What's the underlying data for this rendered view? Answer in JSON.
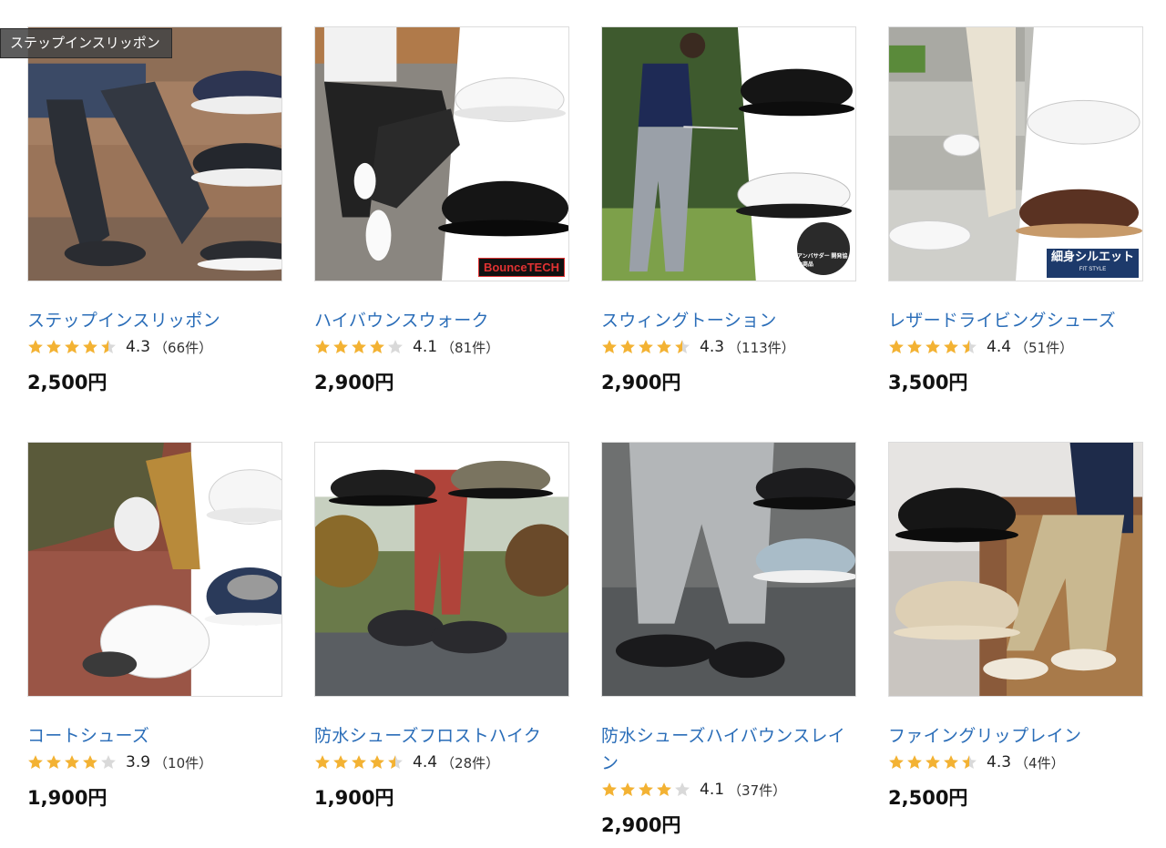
{
  "tooltip": "ステップインスリッポン",
  "colors": {
    "link": "#2a6db8",
    "star_on": "#f3b233",
    "star_off": "#d9d9d9"
  },
  "products": [
    {
      "title": "ステップインスリッポン",
      "rating_value": 4.3,
      "rating": "4.3",
      "count": "（66件）",
      "price": "2,500円",
      "stars": [
        1,
        1,
        1,
        1,
        0.5
      ],
      "image_icon": "slip-on-shoe-image"
    },
    {
      "title": "ハイバウンスウォーク",
      "rating_value": 4.1,
      "rating": "4.1",
      "count": "（81件）",
      "price": "2,900円",
      "stars": [
        1,
        1,
        1,
        1,
        0
      ],
      "image_icon": "walking-shoe-image",
      "badge": "BounceTECH"
    },
    {
      "title": "スウィングトーション",
      "rating_value": 4.3,
      "rating": "4.3",
      "count": "（113件）",
      "price": "2,900円",
      "stars": [
        1,
        1,
        1,
        1,
        0.5
      ],
      "image_icon": "golf-shoe-image",
      "badge": "アンバサダー 開発協力商品"
    },
    {
      "title": "レザードライビングシューズ",
      "rating_value": 4.4,
      "rating": "4.4",
      "count": "（51件）",
      "price": "3,500円",
      "stars": [
        1,
        1,
        1,
        1,
        0.5
      ],
      "image_icon": "leather-shoe-image",
      "badge": "細身シルエット",
      "badge_sub": "FIT STYLE"
    },
    {
      "title": "コートシューズ",
      "rating_value": 3.9,
      "rating": "3.9",
      "count": "（10件）",
      "price": "1,900円",
      "stars": [
        1,
        1,
        1,
        1,
        0
      ],
      "image_icon": "court-shoe-image"
    },
    {
      "title": "防水シューズフロストハイク",
      "rating_value": 4.4,
      "rating": "4.4",
      "count": "（28件）",
      "price": "1,900円",
      "stars": [
        1,
        1,
        1,
        1,
        0.5
      ],
      "image_icon": "hiking-shoe-image"
    },
    {
      "title": "防水シューズハイバウンスレイン",
      "rating_value": 4.1,
      "rating": "4.1",
      "count": "（37件）",
      "price": "2,900円",
      "stars": [
        1,
        1,
        1,
        1,
        0
      ],
      "image_icon": "rain-shoe-image"
    },
    {
      "title": "ファイングリップレイン",
      "rating_value": 4.3,
      "rating": "4.3",
      "count": "（4件）",
      "price": "2,500円",
      "stars": [
        1,
        1,
        1,
        1,
        0.5
      ],
      "image_icon": "grip-shoe-image"
    }
  ]
}
